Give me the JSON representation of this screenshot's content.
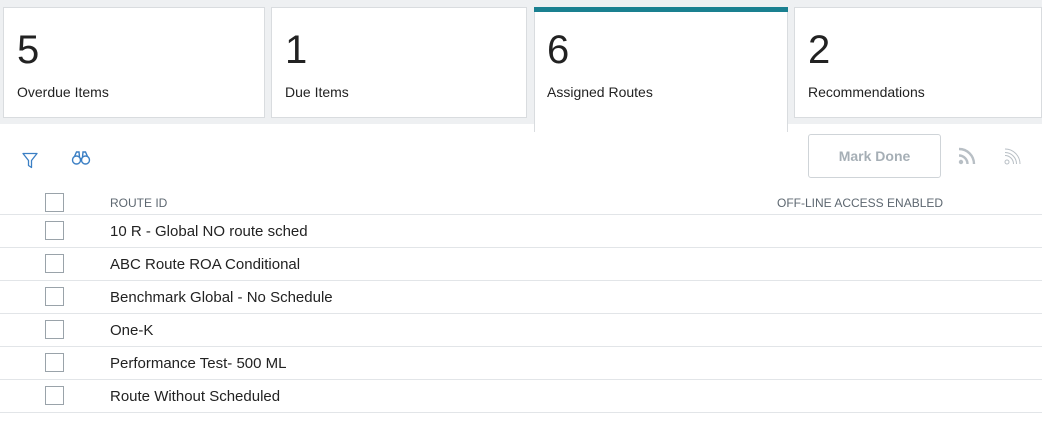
{
  "colors": {
    "accent": "#1a8090",
    "icon_blue": "#3b7fc4",
    "icon_gray": "#b8bfc5"
  },
  "tabs": [
    {
      "count": "5",
      "label": "Overdue Items",
      "active": false
    },
    {
      "count": "1",
      "label": "Due Items",
      "active": false
    },
    {
      "count": "6",
      "label": "Assigned Routes",
      "active": true
    },
    {
      "count": "2",
      "label": "Recommendations",
      "active": false
    }
  ],
  "toolbar": {
    "filter_icon": "filter-icon",
    "search_icon": "binoculars-icon",
    "mark_done_label": "Mark Done",
    "feed_icon": "rss-icon"
  },
  "grid": {
    "columns": [
      "ROUTE ID",
      "OFF-LINE ACCESS ENABLED"
    ],
    "rows": [
      {
        "route_id": "10 R - Global NO route sched"
      },
      {
        "route_id": "ABC Route ROA Conditional"
      },
      {
        "route_id": "Benchmark Global - No Schedule"
      },
      {
        "route_id": "One-K"
      },
      {
        "route_id": "Performance Test- 500 ML"
      },
      {
        "route_id": "Route Without Scheduled"
      }
    ]
  }
}
